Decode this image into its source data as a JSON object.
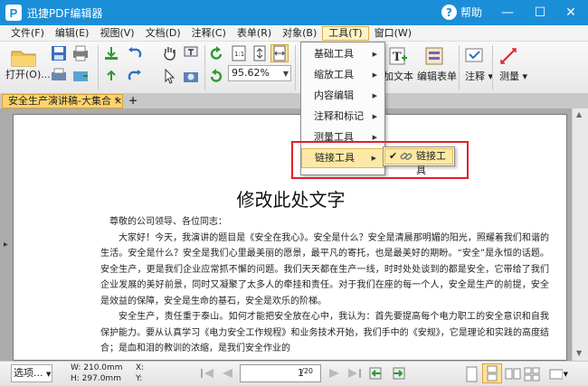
{
  "titlebar": {
    "app_title": "迅捷PDF编辑器",
    "logo_letter": "P",
    "help_label": "帮助",
    "minimize": "—",
    "maximize": "☐",
    "close": "✕"
  },
  "menubar": {
    "items": [
      "文件(F)",
      "编辑(E)",
      "视图(V)",
      "文档(D)",
      "注释(C)",
      "表单(R)",
      "对象(B)",
      "工具(T)",
      "窗口(W)"
    ],
    "active": "工具(T)"
  },
  "toolbar": {
    "open_label": "打开(O)...",
    "zoom_value": "95.62%",
    "add_text_label": "加文本",
    "edit_form_label": "编辑表单",
    "annotate_label": "注释",
    "measure_label": "测量"
  },
  "tabbar": {
    "doc_tab": "安全生产演讲稿-大集合 *",
    "close": "×",
    "add": "+"
  },
  "tools_menu": {
    "items": [
      {
        "label": "基础工具"
      },
      {
        "label": "缩放工具"
      },
      {
        "label": "内容编辑"
      },
      {
        "label": "注释和标记"
      },
      {
        "label": "测量工具"
      },
      {
        "label": "链接工具"
      }
    ],
    "submenu_item": "链接工具"
  },
  "document": {
    "title": "修改此处文字",
    "greeting": "尊敬的公司领导、各位同志：",
    "paragraphs": [
      "大家好！今天，我演讲的题目是《安全在我心》。安全是什么？安全是清晨那明媚的阳光，照耀着我们和谐的生活。安全是什么？安全是我们心里最美丽的愿景，最平凡的寄托，也是最美好的期盼。“安全”是永恒的话题。安全生产，更是我们企业应常抓不懈的问题。我们天天都在生产一线，时时处处谈到的都是安全，它带给了我们企业发展的美好前景，同时又凝聚了太多人的牵挂和责任。对于我们在座的每一个人，安全是生产的前提，安全是效益的保障，安全是生命的基石，安全是欢乐的阶梯。",
      "安全生产，责任重于泰山。如何才能把安全放在心中，我认为：首先要提高每个电力职工的安全意识和自我保护能力。要从认真学习《电力安全工作规程》和业务技术开始，我们手中的《安规》，它是理论和实践的高度结合；是血和泪的教训的浓缩，是我们安全作业的"
    ]
  },
  "statusbar": {
    "view_select": "选项...",
    "width": "W: 210.0mm",
    "height": "H: 297.0mm",
    "x": "X:",
    "y": "Y:",
    "page_current": "1",
    "page_total": "/20"
  }
}
